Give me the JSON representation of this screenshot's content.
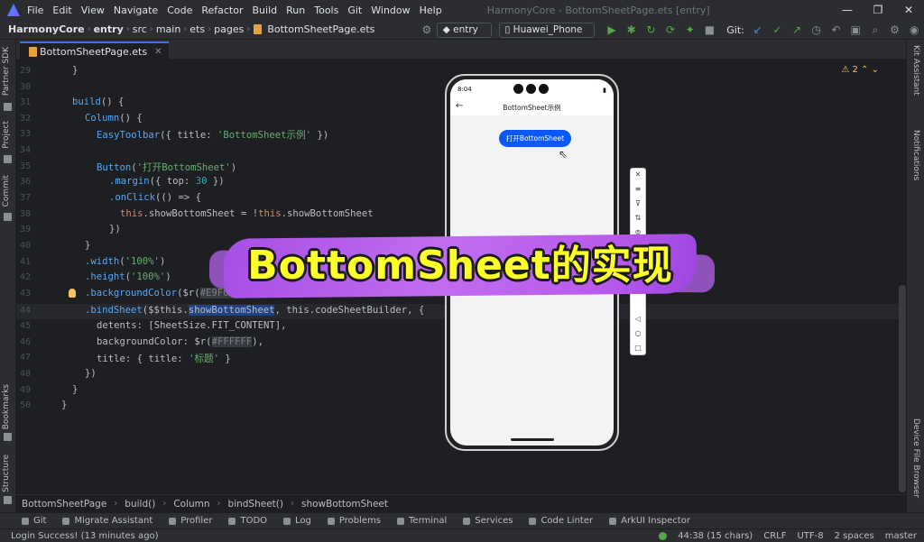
{
  "window": {
    "menu": [
      "File",
      "Edit",
      "View",
      "Navigate",
      "Code",
      "Refactor",
      "Build",
      "Run",
      "Tools",
      "Git",
      "Window",
      "Help"
    ],
    "title": "HarmonyCore - BottomSheetPage.ets [entry]",
    "controls": [
      "—",
      "❐",
      "✕"
    ]
  },
  "navbar": {
    "breadcrumbs": [
      "HarmonyCore",
      "entry",
      "src",
      "main",
      "ets",
      "pages",
      "BottomSheetPage.ets"
    ],
    "module_selector": "entry",
    "device_selector": "Huawei_Phone",
    "git_label": "Git:"
  },
  "left_strip": [
    "Partner SDK",
    "Project",
    "Commit",
    "Bookmarks",
    "Structure"
  ],
  "right_strip": [
    "Kit Assistant",
    "Notifications",
    "Device File Browser"
  ],
  "tab": {
    "label": "BottomSheetPage.ets",
    "close": "✕"
  },
  "editor": {
    "warning_count": "2",
    "line_numbers": [
      "29",
      "30",
      "31",
      "32",
      "33",
      "34",
      "35",
      "36",
      "37",
      "38",
      "39",
      "40",
      "41",
      "42",
      "43",
      "44",
      "45",
      "46",
      "47",
      "48",
      "49",
      "50"
    ]
  },
  "code": {
    "l29": "}",
    "l31_kw": "build",
    "l31_rest": "() {",
    "l32_fn": "Column",
    "l32_rest": "() {",
    "l33_fn": "EasyToolbar",
    "l33_a": "({ title: ",
    "l33_str": "'BottomSheet示例'",
    "l33_b": " })",
    "l35_fn": "Button",
    "l35_a": "(",
    "l35_str": "'打开BottomSheet'",
    "l35_b": ")",
    "l36_fn": ".margin",
    "l36_a": "({ top: ",
    "l36_num": "30",
    "l36_b": " })",
    "l37_fn": ".onClick",
    "l37_a": "(() => {",
    "l38_kw": "this",
    "l38_a": ".showBottomSheet = !",
    "l38_kw2": "this",
    "l38_b": ".showBottomSheet",
    "l39": "})",
    "l40": "}",
    "l41_fn": ".width",
    "l41_a": "(",
    "l41_str": "'100%'",
    "l41_b": ")",
    "l42_fn": ".height",
    "l42_a": "(",
    "l42_str": "'100%'",
    "l42_b": ")",
    "l43_fn": ".backgroundColor",
    "l43_a": "($r(",
    "l43_cm": "#E9F0F3",
    "l43_b": "))",
    "l44_fn": ".bindSheet",
    "l44_a": "($$this.",
    "l44_sel": "showBottomSheet",
    "l44_b": ", this.codeSheetBuilder, {",
    "l45_a": "detents: [SheetSize.FIT_CONTENT],",
    "l46_a": "backgroundColor: $r(",
    "l46_cm": "#FFFFFF",
    "l46_b": "),",
    "l47_a": "title: { title: ",
    "l47_str": "'标题'",
    "l47_b": " }",
    "l48": "})",
    "l49": "}",
    "l50": "}"
  },
  "phone": {
    "time": "8:04",
    "battery": "▮",
    "back": "←",
    "title": "BottomSheet示例",
    "button": "打开BottomSheet"
  },
  "emulator_tools": [
    "✕",
    "≡",
    "⊽",
    "⇅",
    "⊚",
    "◁",
    "○",
    "□"
  ],
  "overlay": {
    "caption": "BottomSheet的实现"
  },
  "code_breadcrumbs": [
    "BottomSheetPage",
    "build()",
    "Column",
    "bindSheet()",
    "showBottomSheet"
  ],
  "tool_windows": [
    "Git",
    "Migrate Assistant",
    "Profiler",
    "TODO",
    "Log",
    "Problems",
    "Terminal",
    "Services",
    "Code Linter",
    "ArkUI Inspector"
  ],
  "status": {
    "message": "Login Success! (13 minutes ago)",
    "position": "44:38 (15 chars)",
    "line_sep": "CRLF",
    "encoding": "UTF-8",
    "indent": "2 spaces",
    "branch": "master"
  },
  "colors": {
    "accent": "#3574f0",
    "overlay_text": "#ffff2a",
    "overlay_stroke": "#b663ee",
    "phone_button": "#0a59f7"
  }
}
